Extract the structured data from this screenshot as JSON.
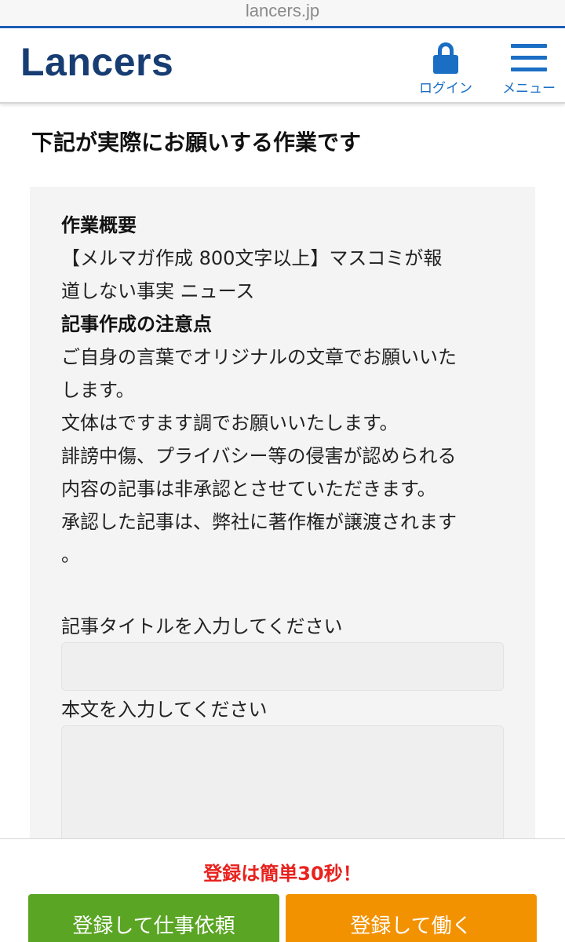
{
  "browser": {
    "url": "lancers.jp"
  },
  "header": {
    "logo": "Lancers",
    "login_label": "ログイン",
    "menu_label": "メニュー"
  },
  "page": {
    "title": "下記が実際にお願いする作業です"
  },
  "task": {
    "summary_heading": "作業概要",
    "summary_lines": [
      "【メルマガ作成 800文字以上】マスコミが報",
      "道しない事実 ニュース"
    ],
    "notes_heading": "記事作成の注意点",
    "notes_lines": [
      "ご自身の言葉でオリジナルの文章でお願いいた",
      "します。",
      "文体はですます調でお願いいたします。",
      "誹謗中傷、プライバシー等の侵害が認められる",
      "内容の記事は非承認とさせていただきます。",
      "承認した記事は、弊社に著作権が譲渡されます",
      "。"
    ]
  },
  "form": {
    "title_label": "記事タイトルを入力してください",
    "title_value": "",
    "body_label": "本文を入力してください",
    "body_value": ""
  },
  "footer": {
    "promo": "登録は簡単30秒！",
    "client_button": "登録して仕事依頼",
    "worker_button": "登録して働く"
  },
  "colors": {
    "brand": "#173d73",
    "accent_blue": "#1a6ec4",
    "promo_red": "#e8221d",
    "client_green": "#5aa524",
    "worker_orange": "#f39200"
  }
}
